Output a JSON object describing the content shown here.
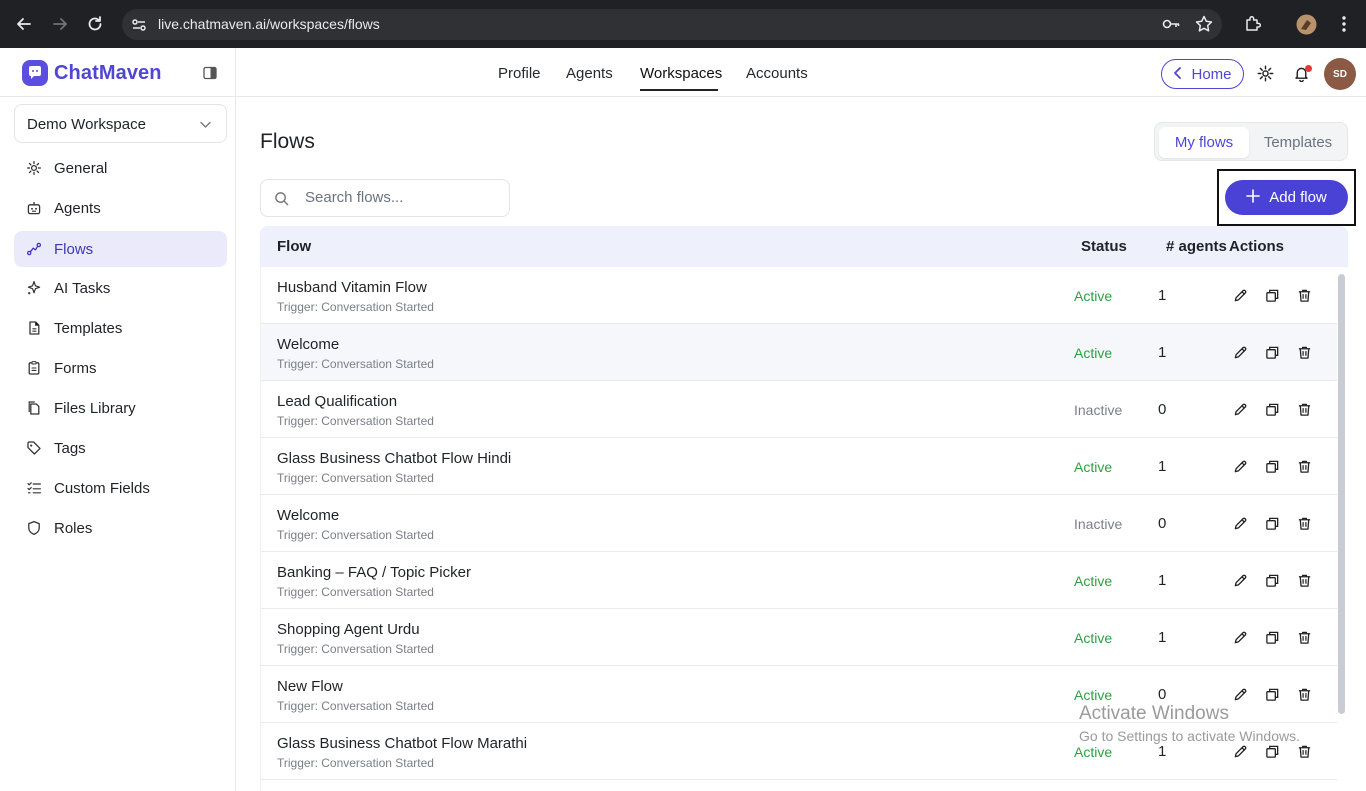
{
  "browser": {
    "url": "live.chatmaven.ai/workspaces/flows"
  },
  "brand": {
    "name": "ChatMaven",
    "accent": "#5046d6"
  },
  "topnav": {
    "items": [
      "Profile",
      "Agents",
      "Workspaces",
      "Accounts"
    ],
    "active": "Workspaces"
  },
  "header": {
    "home_label": "Home",
    "avatar_initials": "SD"
  },
  "sidebar": {
    "workspace": "Demo Workspace",
    "items": [
      {
        "label": "General",
        "icon": "gear-icon"
      },
      {
        "label": "Agents",
        "icon": "robot-icon"
      },
      {
        "label": "Flows",
        "icon": "flow-icon",
        "active": true
      },
      {
        "label": "AI Tasks",
        "icon": "sparkle-icon"
      },
      {
        "label": "Templates",
        "icon": "document-icon"
      },
      {
        "label": "Forms",
        "icon": "clipboard-icon"
      },
      {
        "label": "Files Library",
        "icon": "files-icon"
      },
      {
        "label": "Tags",
        "icon": "tag-icon"
      },
      {
        "label": "Custom Fields",
        "icon": "checklist-icon"
      },
      {
        "label": "Roles",
        "icon": "shield-icon"
      }
    ]
  },
  "main": {
    "title": "Flows",
    "tabs": [
      "My flows",
      "Templates"
    ],
    "active_tab": "My flows",
    "search_placeholder": "Search flows...",
    "add_label": "Add flow"
  },
  "table": {
    "headers": {
      "flow": "Flow",
      "status": "Status",
      "agents": "# agents",
      "actions": "Actions"
    },
    "status_colors": {
      "Active": "#2ea043",
      "Inactive": "#7a7f87"
    },
    "rows": [
      {
        "name": "Husband Vitamin Flow",
        "trigger": "Trigger: Conversation Started",
        "status": "Active",
        "agents": "1"
      },
      {
        "name": "Welcome",
        "trigger": "Trigger: Conversation Started",
        "status": "Active",
        "agents": "1"
      },
      {
        "name": "Lead Qualification",
        "trigger": "Trigger: Conversation Started",
        "status": "Inactive",
        "agents": "0"
      },
      {
        "name": "Glass Business Chatbot Flow Hindi",
        "trigger": "Trigger: Conversation Started",
        "status": "Active",
        "agents": "1"
      },
      {
        "name": "Welcome",
        "trigger": "Trigger: Conversation Started",
        "status": "Inactive",
        "agents": "0"
      },
      {
        "name": "Banking – FAQ / Topic Picker",
        "trigger": "Trigger: Conversation Started",
        "status": "Active",
        "agents": "1"
      },
      {
        "name": "Shopping Agent Urdu",
        "trigger": "Trigger: Conversation Started",
        "status": "Active",
        "agents": "1"
      },
      {
        "name": "New Flow",
        "trigger": "Trigger: Conversation Started",
        "status": "Active",
        "agents": "0"
      },
      {
        "name": "Glass Business Chatbot Flow Marathi",
        "trigger": "Trigger: Conversation Started",
        "status": "Active",
        "agents": "1"
      }
    ]
  },
  "watermark": {
    "title": "Activate Windows",
    "subtitle": "Go to Settings to activate Windows."
  }
}
